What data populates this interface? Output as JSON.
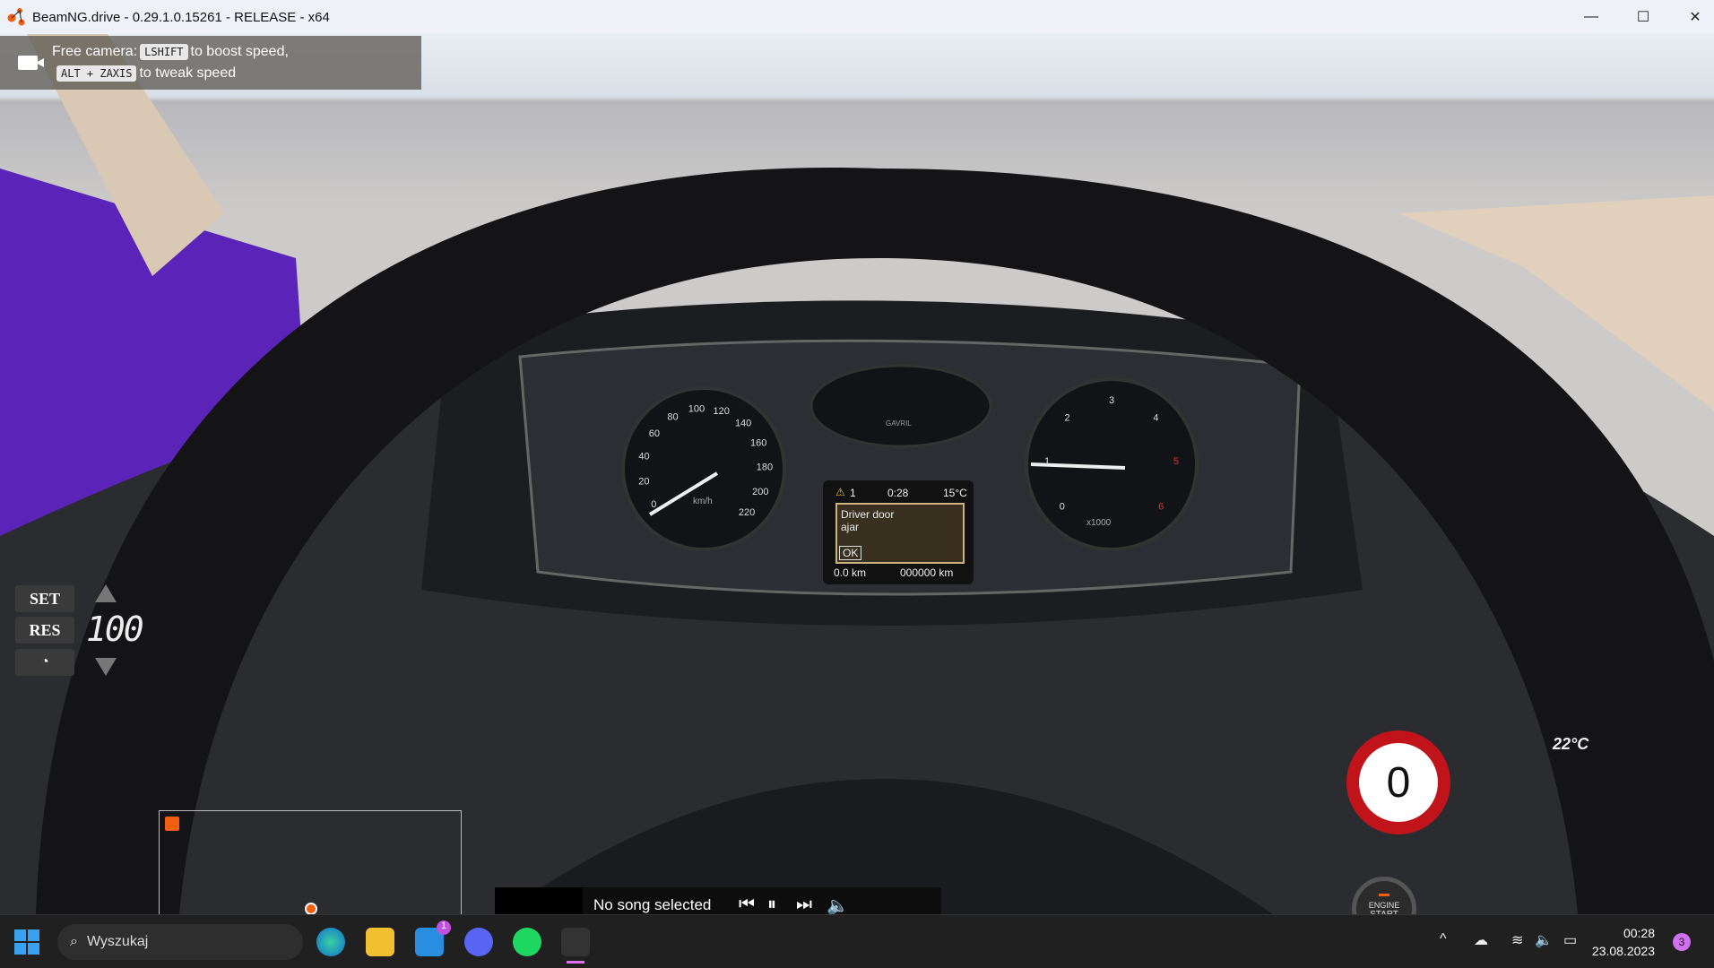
{
  "window": {
    "title": "BeamNG.drive - 0.29.1.0.15261 - RELEASE - x64",
    "minimize": "—",
    "maximize": "☐",
    "close": "✕"
  },
  "hint": {
    "prefix": "Free camera:",
    "key1": "LSHIFT",
    "text1": "to boost speed,",
    "key2": "ALT + ZAXIS",
    "text2": "to tweak speed"
  },
  "cruise": {
    "set": "SET",
    "res": "RES",
    "speed": "100"
  },
  "cluster": {
    "warn_count": "1",
    "time": "0:28",
    "temp": "15°C",
    "message_line1": "Driver door",
    "message_line2": "ajar",
    "ok": "OK",
    "trip": "0.0 km",
    "odo": "000000 km",
    "speed_unit": "km/h",
    "rpm_unit": "x1000",
    "brand": "GAVRIL",
    "speed_ticks": [
      "0",
      "20",
      "40",
      "60",
      "80",
      "100",
      "120",
      "140",
      "160",
      "180",
      "200",
      "220"
    ],
    "rpm_ticks": [
      "0",
      "1",
      "2",
      "3",
      "4",
      "5",
      "6"
    ]
  },
  "speed_sign": {
    "value": "0"
  },
  "engine": {
    "l1": "ENGINE",
    "l2": "START"
  },
  "climate": {
    "temp": "22°C"
  },
  "music": {
    "title": "No song selected"
  },
  "taskbar": {
    "search_placeholder": "Wyszukaj",
    "mail_badge": "1",
    "time": "00:28",
    "date": "23.08.2023",
    "notif_count": "3"
  }
}
